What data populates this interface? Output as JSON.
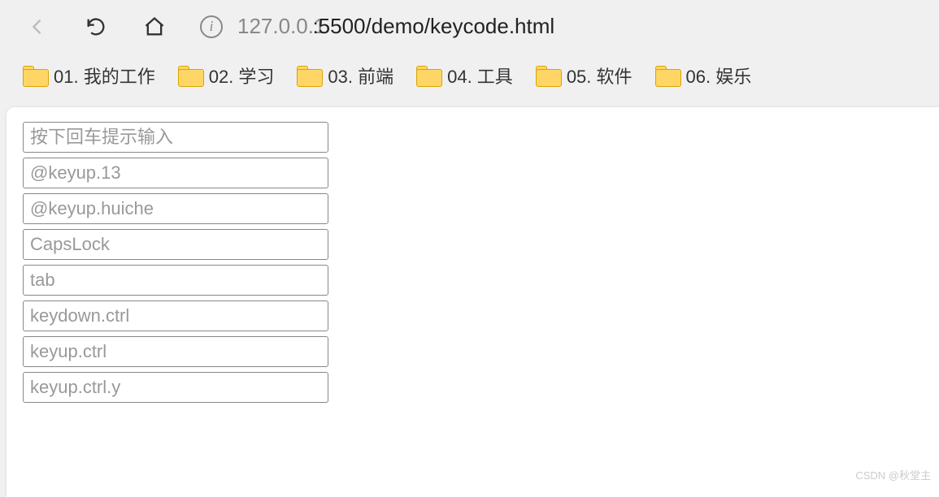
{
  "browser": {
    "url_host": "127.0.0.1",
    "url_port_path": ":5500/demo/keycode.html"
  },
  "bookmarks": [
    {
      "label": "01. 我的工作"
    },
    {
      "label": "02. 学习"
    },
    {
      "label": "03. 前端"
    },
    {
      "label": "04. 工具"
    },
    {
      "label": "05. 软件"
    },
    {
      "label": "06. 娱乐"
    }
  ],
  "inputs": [
    {
      "placeholder": "按下回车提示输入",
      "value": ""
    },
    {
      "placeholder": "@keyup.13",
      "value": ""
    },
    {
      "placeholder": "@keyup.huiche",
      "value": ""
    },
    {
      "placeholder": "CapsLock",
      "value": ""
    },
    {
      "placeholder": "tab",
      "value": ""
    },
    {
      "placeholder": "keydown.ctrl",
      "value": ""
    },
    {
      "placeholder": "keyup.ctrl",
      "value": ""
    },
    {
      "placeholder": "keyup.ctrl.y",
      "value": ""
    }
  ],
  "watermark": "CSDN @秋堂主"
}
